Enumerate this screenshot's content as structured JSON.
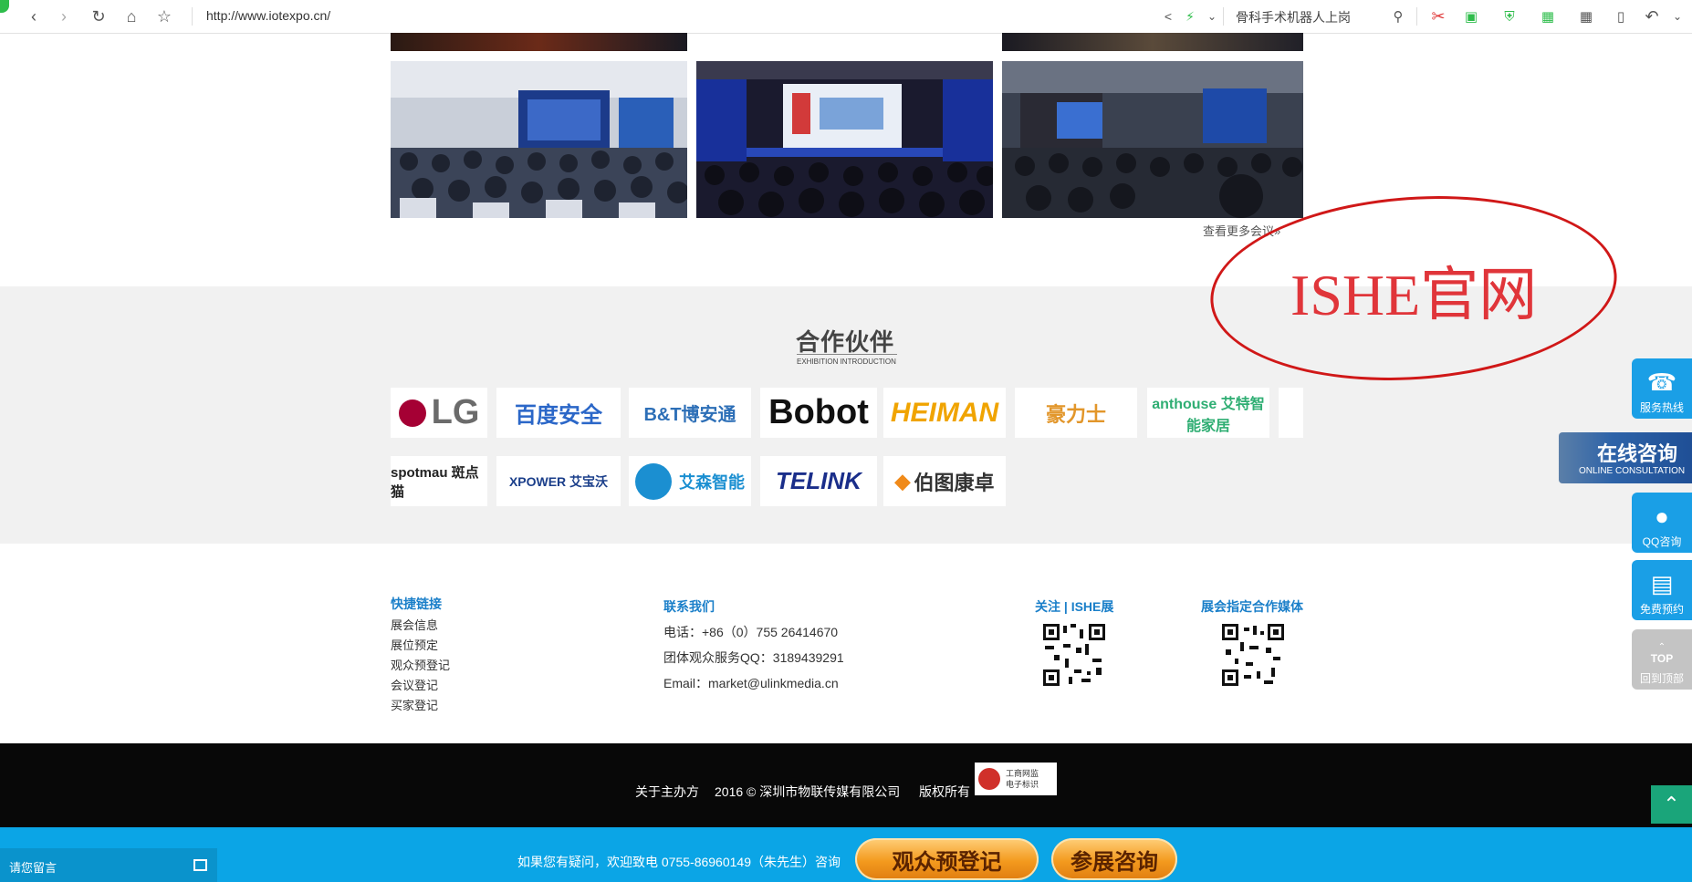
{
  "browser": {
    "url": "http://www.iotexpo.cn/",
    "search_text": "骨科手术机器人上岗"
  },
  "gallery": {
    "more_link": "查看更多会议»"
  },
  "watermark": {
    "text": "ISHE官网"
  },
  "partners": {
    "title": "合作伙伴",
    "subtitle": "EXHIBITION INTRODUCTION",
    "logos": [
      {
        "name": "LG",
        "text": "LG",
        "color": "#a50034"
      },
      {
        "name": "baidu-security",
        "text": "百度安全",
        "color": "#2b67c8"
      },
      {
        "name": "bt",
        "text": "B&T博安通",
        "color": "#2d6fb7"
      },
      {
        "name": "bobot",
        "text": "Bobot",
        "color": "#111111"
      },
      {
        "name": "heiman",
        "text": "HEIMAN",
        "color": "#f0a400"
      },
      {
        "name": "holish",
        "text": "豪力士",
        "color": "#e2962a"
      },
      {
        "name": "anthouse",
        "text": "anthouse 艾特智能家居",
        "color": "#2fae73"
      },
      {
        "name": "spotmau",
        "text": "spotmau 斑点猫",
        "color": "#222222"
      },
      {
        "name": "xpower",
        "text": "XPOWER 艾宝沃",
        "color": "#1a3e8a"
      },
      {
        "name": "aisenz",
        "text": "艾森智能",
        "color": "#1b8fd1"
      },
      {
        "name": "telink",
        "text": "TELINK",
        "color": "#1a2e8a"
      },
      {
        "name": "potom",
        "text": "伯图康卓",
        "color": "#333333"
      }
    ]
  },
  "footer": {
    "quick_links_title": "快捷链接",
    "quick_links": [
      "展会信息",
      "展位预定",
      "观众预登记",
      "会议登记",
      "买家登记"
    ],
    "contact_title": "联系我们",
    "phone": "电话：+86（0）755 26414670",
    "qq": "团体观众服务QQ：3189439291",
    "email": "Email：market@ulinkmedia.cn",
    "follow_title": "关注 | ISHE展",
    "media_title": "展会指定合作媒体"
  },
  "copyright": {
    "about": "关于主办方",
    "text": "2016 © 深圳市物联传媒有限公司",
    "rights": "版权所有",
    "badge_line1": "工商网监",
    "badge_line2": "电子标识"
  },
  "bottom_bar": {
    "leave_message": "请您留言",
    "hotline_text": "如果您有疑问，欢迎致电 0755-86960149（朱先生）咨询",
    "btn_register": "观众预登记",
    "btn_consult": "参展咨询"
  },
  "side": {
    "hotline": "服务热线",
    "online_title": "在线咨询",
    "online_sub": "ONLINE CONSULTATION",
    "qq": "QQ咨询",
    "booking": "免费预约",
    "top": "TOP",
    "back_top": "回到顶部"
  }
}
